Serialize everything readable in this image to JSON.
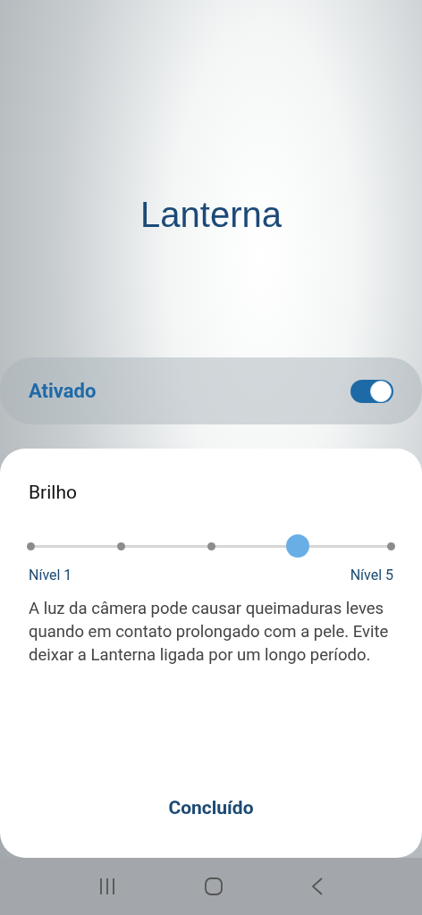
{
  "title": "Lanterna",
  "toggle": {
    "label": "Ativado",
    "on": true
  },
  "sheet": {
    "title": "Brilho",
    "slider": {
      "level": 0.75,
      "min_label": "Nível 1",
      "max_label": "Nível 5"
    },
    "description": "A luz da câmera pode causar queimaduras leves quando em contato prolongado com a pele. Evite deixar a Lanterna ligada por um longo período.",
    "done_button": "Concluído"
  }
}
